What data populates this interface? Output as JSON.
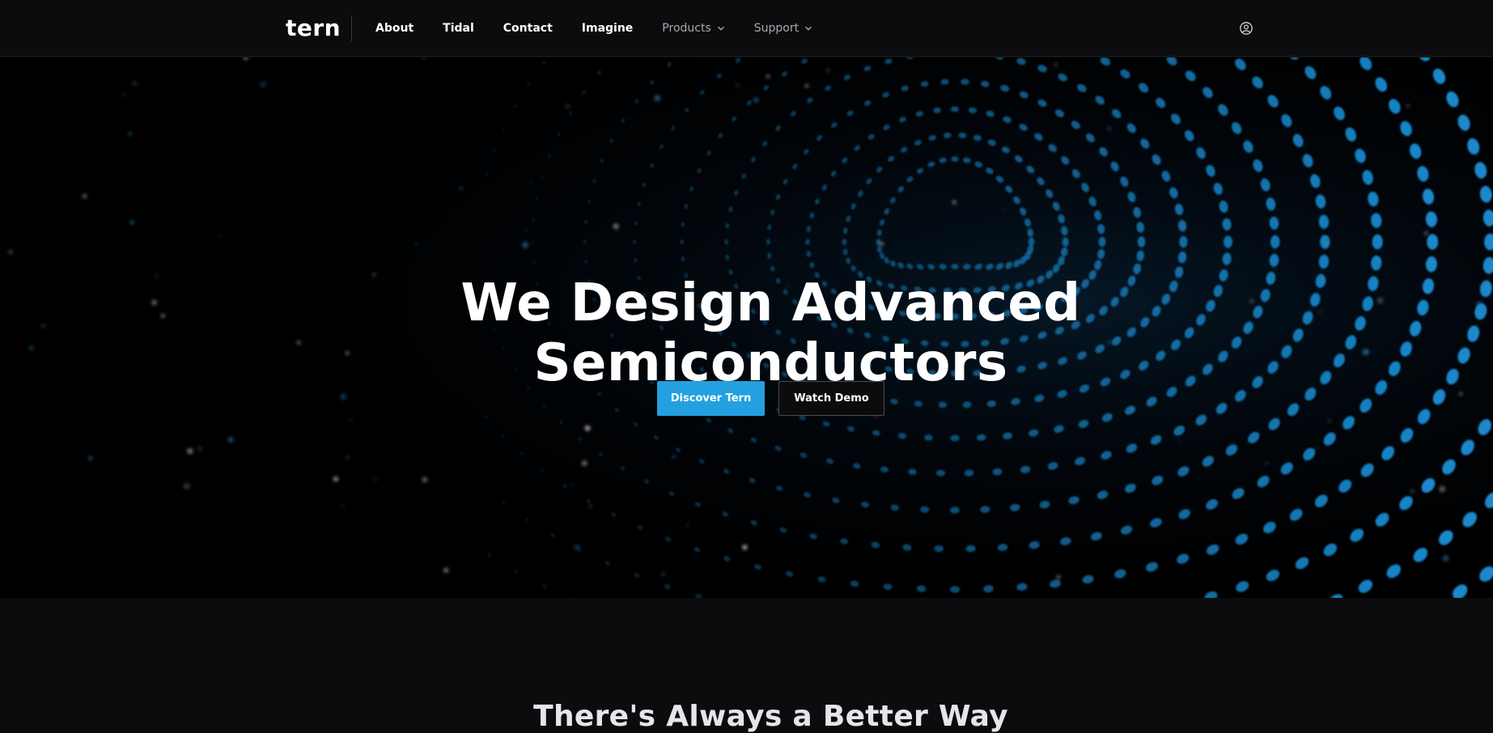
{
  "brand": {
    "name": "tern"
  },
  "nav": {
    "items": [
      {
        "label": "About",
        "style": "primary"
      },
      {
        "label": "Tidal",
        "style": "primary"
      },
      {
        "label": "Contact",
        "style": "primary"
      },
      {
        "label": "Imagine",
        "style": "primary"
      },
      {
        "label": "Products",
        "style": "dropdown"
      },
      {
        "label": "Support",
        "style": "dropdown"
      }
    ],
    "user_icon": "user-circle-icon"
  },
  "hero": {
    "title_line1": "We Design Advanced",
    "title_line2": "Semiconductors",
    "primary_cta": "Discover Tern",
    "secondary_cta": "Watch Demo",
    "background": "blue-dot-particle-wave"
  },
  "section": {
    "title": "There's Always a Better Way"
  },
  "colors": {
    "accent": "#23a0e0",
    "background": "#0c0c0e",
    "hero_background": "#000000",
    "dot_color": "#1a8fd6"
  }
}
